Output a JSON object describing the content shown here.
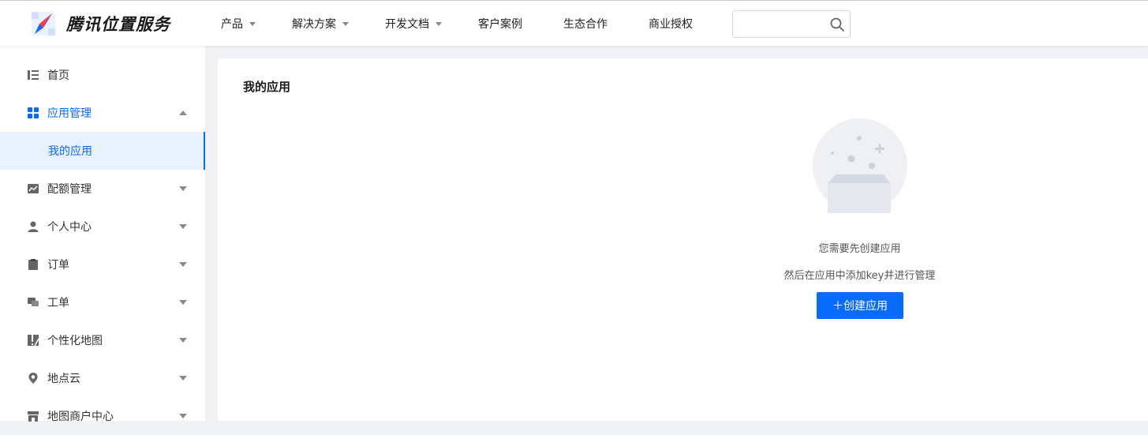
{
  "header": {
    "brand": "腾讯位置服务",
    "nav": [
      {
        "label": "产品",
        "dropdown": true
      },
      {
        "label": "解决方案",
        "dropdown": true
      },
      {
        "label": "开发文档",
        "dropdown": true
      },
      {
        "label": "客户案例",
        "dropdown": false
      },
      {
        "label": "生态合作",
        "dropdown": false
      },
      {
        "label": "商业授权",
        "dropdown": false
      }
    ],
    "search": {
      "value": "",
      "placeholder": ""
    }
  },
  "sidebar": {
    "items": [
      {
        "label": "首页",
        "icon": "list-icon"
      },
      {
        "label": "应用管理",
        "icon": "grid-icon",
        "expanded": true
      },
      {
        "label": "我的应用",
        "sub": true,
        "active": true
      },
      {
        "label": "配额管理",
        "icon": "chart-icon"
      },
      {
        "label": "个人中心",
        "icon": "user-icon"
      },
      {
        "label": "订单",
        "icon": "clipboard-icon"
      },
      {
        "label": "工单",
        "icon": "chat-icon"
      },
      {
        "label": "个性化地图",
        "icon": "map-style-icon"
      },
      {
        "label": "地点云",
        "icon": "location-pin-icon"
      },
      {
        "label": "地图商户中心",
        "icon": "store-icon"
      }
    ]
  },
  "main": {
    "title": "我的应用",
    "empty_line1": "您需要先创建应用",
    "empty_line2": "然后在应用中添加key并进行管理",
    "create_button": "＋创建应用"
  },
  "colors": {
    "accent": "#0a6cff",
    "active_bg": "#e8f1ff",
    "page_bg": "#f0f2f5"
  }
}
